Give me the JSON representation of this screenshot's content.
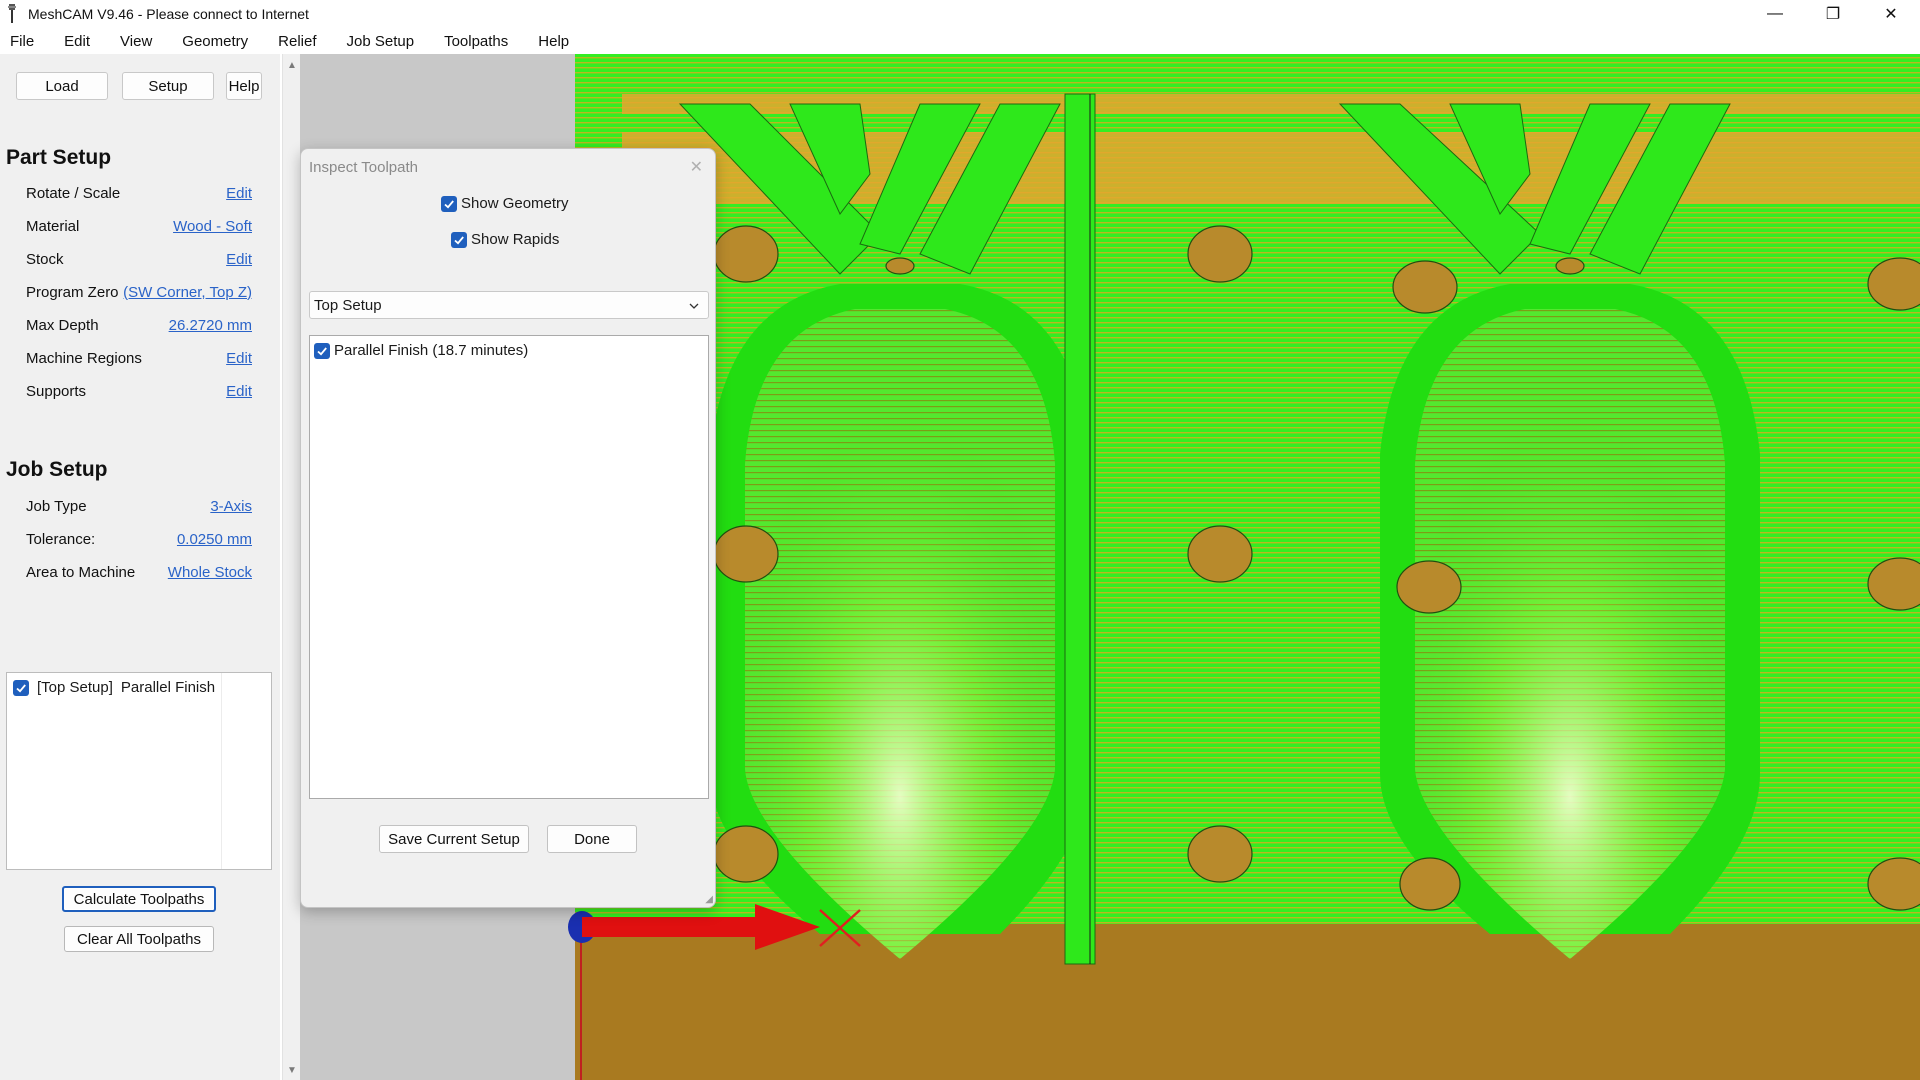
{
  "window": {
    "title": "MeshCAM V9.46 - Please connect to Internet",
    "minimize": "—",
    "maximize": "❐",
    "close": "✕"
  },
  "menu": [
    "File",
    "Edit",
    "View",
    "Geometry",
    "Relief",
    "Job Setup",
    "Toolpaths",
    "Help"
  ],
  "toolbar": {
    "load": "Load",
    "setup": "Setup",
    "help": "Help"
  },
  "part_setup": {
    "heading": "Part Setup",
    "rows": [
      {
        "label": "Rotate / Scale",
        "value": "Edit"
      },
      {
        "label": "Material",
        "value": "Wood - Soft"
      },
      {
        "label": "Stock",
        "value": "Edit"
      },
      {
        "label": "Program Zero",
        "value": " (SW Corner, Top Z)"
      },
      {
        "label": "Max Depth",
        "value": "26.2720 mm"
      },
      {
        "label": "Machine Regions",
        "value": "Edit"
      },
      {
        "label": "Supports",
        "value": "Edit"
      }
    ]
  },
  "job_setup": {
    "heading": "Job Setup",
    "rows": [
      {
        "label": "Job Type",
        "value": "3-Axis"
      },
      {
        "label": "Tolerance:",
        "value": "0.0250 mm"
      },
      {
        "label": "Area to Machine",
        "value": "Whole Stock"
      }
    ]
  },
  "operations": {
    "items": [
      {
        "setup": "[Top Setup]",
        "name": "Parallel Finish",
        "checked": true
      }
    ]
  },
  "buttons": {
    "calculate": "Calculate Toolpaths",
    "clear": "Clear All Toolpaths"
  },
  "dialog": {
    "title": "Inspect Toolpath",
    "close": "✕",
    "show_geometry": "Show Geometry",
    "show_rapids": "Show Rapids",
    "setup_select": "Top Setup",
    "toolpaths": [
      {
        "label": "Parallel Finish (18.7 minutes)",
        "checked": true
      }
    ],
    "save_button": "Save Current Setup",
    "done_button": "Done"
  },
  "colors": {
    "accent": "#1f5fbd",
    "link": "#2a63c8",
    "toolpath_green": "#22ee22",
    "stock_orange": "#e7a52f",
    "stock_brown": "#a97a20",
    "axis_red": "#e01010"
  },
  "icons": [
    "app-icon",
    "checkbox-checked-icon",
    "chevron-down-icon",
    "close-icon",
    "resize-grip-icon",
    "scroll-up-arrow-icon",
    "scroll-down-arrow-icon"
  ]
}
